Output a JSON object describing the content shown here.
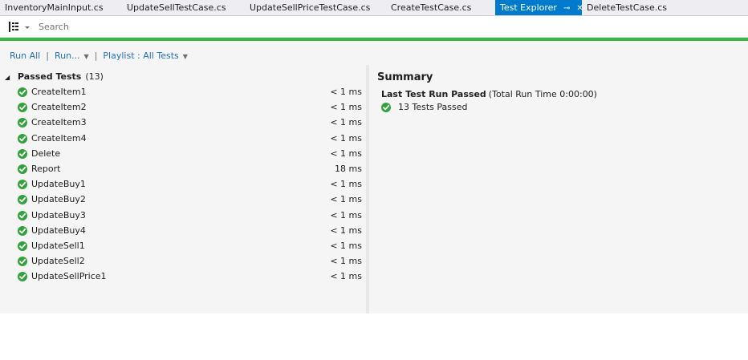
{
  "tabs": [
    {
      "label": "InventoryMainInput.cs",
      "active": false
    },
    {
      "label": "UpdateSellTestCase.cs",
      "active": false
    },
    {
      "label": "UpdateSellPriceTestCase.cs",
      "active": false
    },
    {
      "label": "CreateTestCase.cs",
      "active": false
    },
    {
      "label": "Test Explorer",
      "active": true
    },
    {
      "label": "DeleteTestCase.cs",
      "active": false
    }
  ],
  "tab_icons": {
    "pin": "pin-icon",
    "close": "close-icon"
  },
  "toolbar": {
    "group_icon": "group-by-icon",
    "search_placeholder": "Search"
  },
  "accent_colors": {
    "active_tab": "#007acc",
    "status_bar": "#33bb3f",
    "link": "#1e6fc3",
    "pass_icon": "#33a23c"
  },
  "actions": {
    "run_all": "Run All",
    "run": "Run...",
    "playlist": "Playlist : All Tests"
  },
  "group": {
    "title": "Passed Tests",
    "count": "(13)",
    "expanded": true
  },
  "tests": [
    {
      "name": "CreateItem1",
      "duration": "< 1 ms",
      "status": "passed"
    },
    {
      "name": "CreateItem2",
      "duration": "< 1 ms",
      "status": "passed"
    },
    {
      "name": "CreateItem3",
      "duration": "< 1 ms",
      "status": "passed"
    },
    {
      "name": "CreateItem4",
      "duration": "< 1 ms",
      "status": "passed"
    },
    {
      "name": "Delete",
      "duration": "< 1 ms",
      "status": "passed"
    },
    {
      "name": "Report",
      "duration": "18 ms",
      "status": "passed"
    },
    {
      "name": "UpdateBuy1",
      "duration": "< 1 ms",
      "status": "passed"
    },
    {
      "name": "UpdateBuy2",
      "duration": "< 1 ms",
      "status": "passed"
    },
    {
      "name": "UpdateBuy3",
      "duration": "< 1 ms",
      "status": "passed"
    },
    {
      "name": "UpdateBuy4",
      "duration": "< 1 ms",
      "status": "passed"
    },
    {
      "name": "UpdateSell1",
      "duration": "< 1 ms",
      "status": "passed"
    },
    {
      "name": "UpdateSell2",
      "duration": "< 1 ms",
      "status": "passed"
    },
    {
      "name": "UpdateSellPrice1",
      "duration": "< 1 ms",
      "status": "passed"
    }
  ],
  "summary": {
    "title": "Summary",
    "last_run_label": "Last Test Run Passed",
    "run_time": "(Total Run Time 0:00:00)",
    "passed_text": "13 Tests Passed"
  }
}
